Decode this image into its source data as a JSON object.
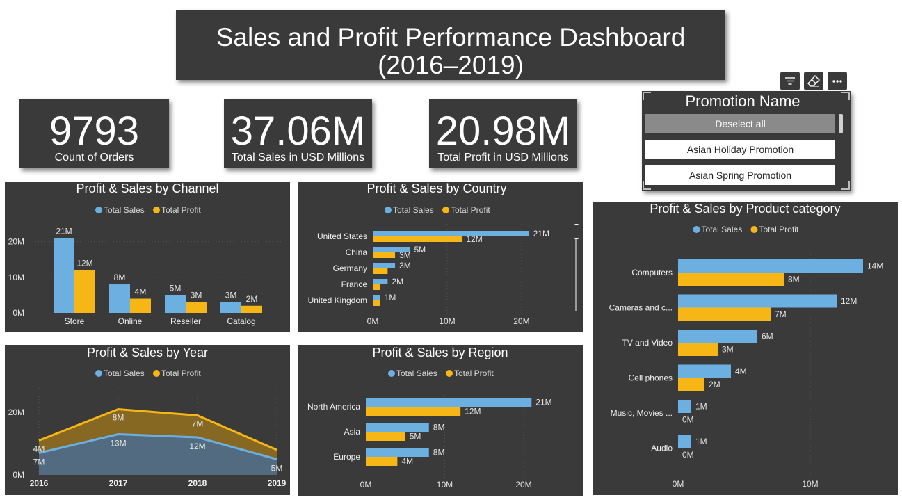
{
  "header": {
    "title_line1": "Sales and Profit Performance Dashboard",
    "title_line2": "(2016–2019)"
  },
  "kpis": [
    {
      "value": "9793",
      "label": "Count of Orders"
    },
    {
      "value": "37.06M",
      "label": "Total Sales in USD Millions"
    },
    {
      "value": "20.98M",
      "label": "Total Profit in USD Millions"
    }
  ],
  "slicer": {
    "title": "Promotion Name",
    "deselect_label": "Deselect all",
    "items": [
      "Asian Holiday Promotion",
      "Asian Spring Promotion"
    ],
    "toolbar_icons": [
      "filter-icon",
      "eraser-icon",
      "more-options-icon"
    ]
  },
  "legend": {
    "sales": "Total Sales",
    "profit": "Total Profit"
  },
  "colors": {
    "panel": "#3a3a3a",
    "sales": "#6cb0e2",
    "profit": "#f6b716"
  },
  "chart_data": [
    {
      "id": "channel",
      "type": "bar",
      "title": "Profit & Sales by Channel",
      "categories": [
        "Store",
        "Online",
        "Reseller",
        "Catalog"
      ],
      "series": [
        {
          "name": "Total Sales",
          "values": [
            21,
            8,
            5,
            3
          ]
        },
        {
          "name": "Total Profit",
          "values": [
            12,
            4,
            3,
            2
          ]
        }
      ],
      "yticks": [
        "0M",
        "10M",
        "20M"
      ],
      "ylim": [
        0,
        25
      ],
      "unit": "M"
    },
    {
      "id": "country",
      "type": "bar",
      "orientation": "horizontal",
      "title": "Profit & Sales by Country",
      "categories": [
        "United States",
        "China",
        "Germany",
        "France",
        "United Kingdom"
      ],
      "series": [
        {
          "name": "Total Sales",
          "values": [
            21,
            5,
            3,
            2,
            1
          ]
        },
        {
          "name": "Total Profit",
          "values": [
            12,
            3,
            2,
            1,
            1
          ]
        }
      ],
      "labels_sales": [
        "21M",
        "5M",
        "3M",
        "2M",
        "1M"
      ],
      "labels_profit": [
        "12M",
        "3M",
        "",
        "",
        ""
      ],
      "xticks": [
        "0M",
        "10M",
        "20M"
      ],
      "xlim": [
        0,
        23
      ]
    },
    {
      "id": "year",
      "type": "area",
      "title": "Profit & Sales by Year",
      "categories": [
        "2016",
        "2017",
        "2018",
        "2019"
      ],
      "series": [
        {
          "name": "Total Sales",
          "values": [
            7,
            13,
            12,
            5
          ]
        },
        {
          "name": "Total Profit",
          "values": [
            4,
            8,
            7,
            3
          ]
        }
      ],
      "labels_sales": [
        "7M",
        "13M",
        "12M",
        "5M"
      ],
      "labels_profit": [
        "4M",
        "8M",
        "7M",
        ""
      ],
      "yticks": [
        "0M",
        "20M"
      ],
      "ylim": [
        0,
        26
      ]
    },
    {
      "id": "region",
      "type": "bar",
      "orientation": "horizontal",
      "title": "Profit & Sales by Region",
      "categories": [
        "North America",
        "Asia",
        "Europe"
      ],
      "series": [
        {
          "name": "Total Sales",
          "values": [
            21,
            8,
            8
          ]
        },
        {
          "name": "Total Profit",
          "values": [
            12,
            5,
            4
          ]
        }
      ],
      "xticks": [
        "0M",
        "10M",
        "20M"
      ],
      "xlim": [
        0,
        23
      ]
    },
    {
      "id": "category",
      "type": "bar",
      "orientation": "horizontal",
      "title": "Profit & Sales by Product category",
      "categories": [
        "Computers",
        "Cameras and c...",
        "TV and Video",
        "Cell phones",
        "Music, Movies ...",
        "Audio"
      ],
      "series": [
        {
          "name": "Total Sales",
          "values": [
            14,
            12,
            6,
            4,
            1,
            1
          ]
        },
        {
          "name": "Total Profit",
          "values": [
            8,
            7,
            3,
            2,
            0,
            0
          ]
        }
      ],
      "xticks": [
        "0M",
        "10M"
      ],
      "xlim": [
        0,
        15
      ]
    }
  ]
}
